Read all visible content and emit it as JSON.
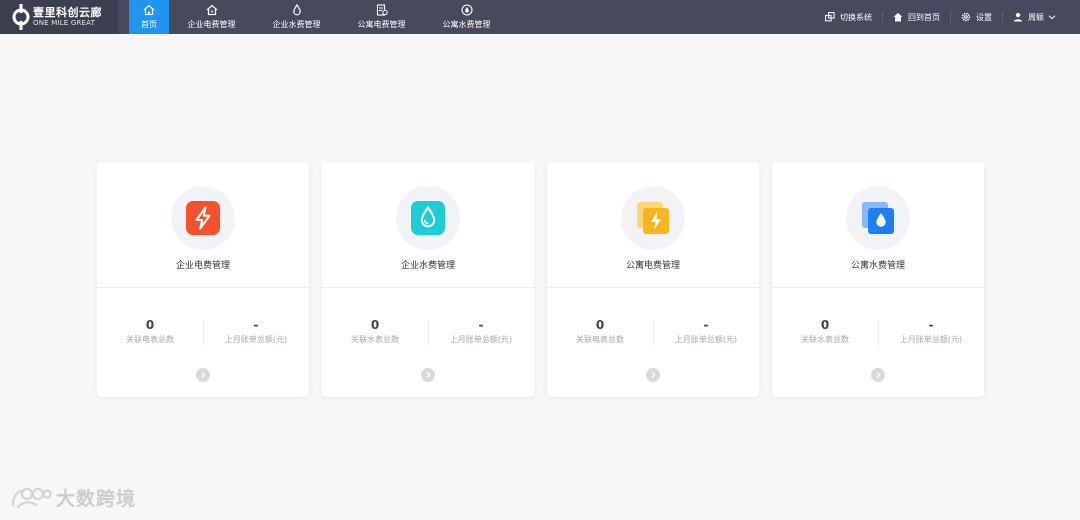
{
  "brand": {
    "name_cn": "壹里科创云廊",
    "name_en": "ONE MILE GREAT"
  },
  "nav": [
    {
      "label": "首页",
      "icon": "home-icon",
      "active": true
    },
    {
      "label": "企业电费管理",
      "icon": "house-power-icon",
      "active": false
    },
    {
      "label": "企业水费管理",
      "icon": "water-drop-icon",
      "active": false
    },
    {
      "label": "公寓电费管理",
      "icon": "bill-icon",
      "active": false
    },
    {
      "label": "公寓水费管理",
      "icon": "drop-circle-icon",
      "active": false
    }
  ],
  "tools": {
    "switch_system": "切换系统",
    "back_home": "回到首页",
    "settings": "设置",
    "user": "周颖"
  },
  "cards": [
    {
      "title": "企业电费管理",
      "icon": "lightning-icon",
      "color": "#f4522d",
      "stat1_value": "0",
      "stat1_label": "关联电表总数",
      "stat2_value": "-",
      "stat2_label": "上月账单总额(元)"
    },
    {
      "title": "企业水费管理",
      "icon": "water-drop-icon",
      "color": "#1ecdd3",
      "stat1_value": "0",
      "stat1_label": "关联水表总数",
      "stat2_value": "-",
      "stat2_label": "上月账单总额(元)"
    },
    {
      "title": "公寓电费管理",
      "icon": "apartment-lightning-icon",
      "color": "#f8b51f",
      "stat1_value": "0",
      "stat1_label": "关联电表总数",
      "stat2_value": "-",
      "stat2_label": "上月账单总额(元)"
    },
    {
      "title": "公寓水费管理",
      "icon": "apartment-water-icon",
      "color": "#1f7ff0",
      "stat1_value": "0",
      "stat1_label": "关联水表总数",
      "stat2_value": "-",
      "stat2_label": "上月账单总额(元)"
    }
  ],
  "watermark": {
    "text": "大数跨境"
  },
  "colors": {
    "topbar": "#474a5c",
    "brand_bg": "#3c3f4f",
    "active_tab": "#1f95f0",
    "background": "#f7f7f7"
  }
}
